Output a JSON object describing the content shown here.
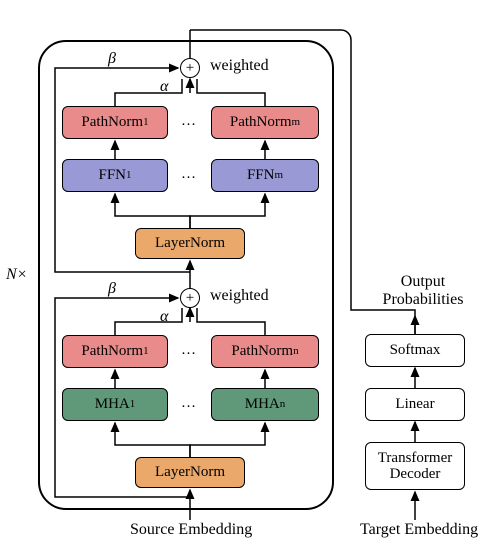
{
  "encoder": {
    "repeat_label": "N×",
    "source_embedding_label": "Source Embedding",
    "top_block": {
      "residual_weight_label": "β",
      "branch_weight_label": "α",
      "weighted_label": "weighted",
      "pathnorm_left": "PathNorm",
      "pathnorm_left_idx": "1",
      "pathnorm_right": "PathNorm",
      "pathnorm_right_idx": "m",
      "ffn_left": "FFN",
      "ffn_left_idx": "1",
      "ffn_right": "FFN",
      "ffn_right_idx": "m",
      "layernorm": "LayerNorm",
      "ellipsis": "…"
    },
    "bottom_block": {
      "residual_weight_label": "β",
      "branch_weight_label": "α",
      "weighted_label": "weighted",
      "pathnorm_left": "PathNorm",
      "pathnorm_left_idx": "1",
      "pathnorm_right": "PathNorm",
      "pathnorm_right_idx": "n",
      "mha_left": "MHA",
      "mha_left_idx": "1",
      "mha_right": "MHA",
      "mha_right_idx": "n",
      "layernorm": "LayerNorm",
      "ellipsis": "…"
    }
  },
  "decoder": {
    "target_embedding_label": "Target Embedding",
    "transformer_decoder": "Transformer\nDecoder",
    "linear": "Linear",
    "softmax": "Softmax",
    "output_prob": "Output\nProbabilities"
  }
}
